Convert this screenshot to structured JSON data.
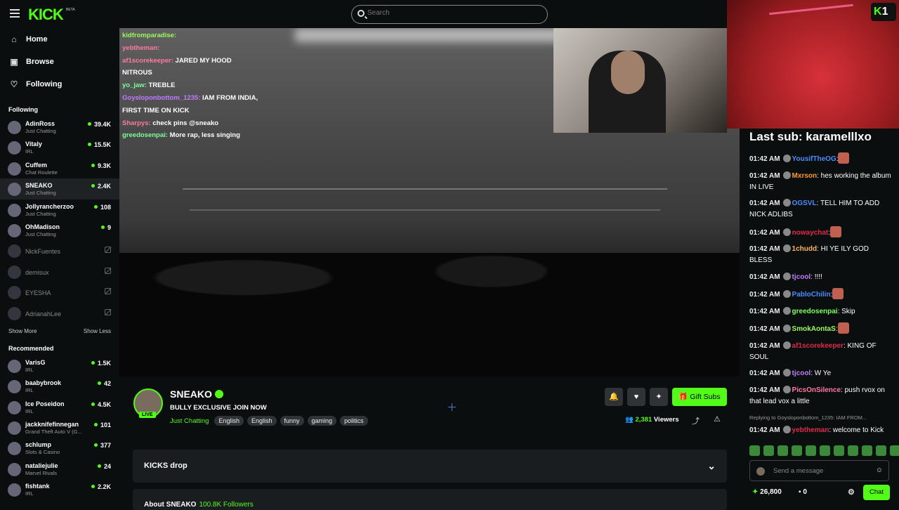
{
  "header": {
    "logo": "KICK",
    "beta": "BETA",
    "search_placeholder": "Search"
  },
  "nav": [
    {
      "icon": "home-icon",
      "glyph": "⌂",
      "label": "Home"
    },
    {
      "icon": "browse-icon",
      "glyph": "▣",
      "label": "Browse"
    },
    {
      "icon": "heart-icon",
      "glyph": "♡",
      "label": "Following"
    }
  ],
  "following_title": "Following",
  "following": [
    {
      "name": "AdinRoss",
      "cat": "Just Chatting",
      "viewers": "39.4K"
    },
    {
      "name": "Vitaly",
      "cat": "IRL",
      "viewers": "15.5K"
    },
    {
      "name": "Cuffem",
      "cat": "Chat Roulette",
      "viewers": "9.3K"
    },
    {
      "name": "SNEAKO",
      "cat": "Just Chatting",
      "viewers": "2.4K"
    },
    {
      "name": "Jollyrancherzoo",
      "cat": "Just Chatting",
      "viewers": "108"
    },
    {
      "name": "OhMadison",
      "cat": "Just Chatting",
      "viewers": "9"
    }
  ],
  "offline": [
    "NickFuentes",
    "demisux",
    "EYESHA",
    "AdrianahLee"
  ],
  "show_more": "Show More",
  "show_less": "Show Less",
  "recommended_title": "Recommended",
  "recommended": [
    {
      "name": "VarisG",
      "cat": "IRL",
      "viewers": "1.5K"
    },
    {
      "name": "baabybrook",
      "cat": "IRL",
      "viewers": "42"
    },
    {
      "name": "Ice Poseidon",
      "cat": "IRL",
      "viewers": "4.5K"
    },
    {
      "name": "jackknifefinnegan",
      "cat": "Grand Theft Auto V (G...",
      "viewers": "101"
    },
    {
      "name": "schlump",
      "cat": "Slots & Casino",
      "viewers": "377"
    },
    {
      "name": "nataliejulie",
      "cat": "Marvel Rivals",
      "viewers": "24"
    },
    {
      "name": "fishtank",
      "cat": "IRL",
      "viewers": "2.2K"
    }
  ],
  "video_chat": [
    {
      "user": "kidfromparadise:",
      "text": ""
    },
    {
      "user": "yebtheman:",
      "text": ""
    },
    {
      "user": "af1scorekeeper:",
      "text": " JARED MY HOOD"
    },
    {
      "user": "",
      "text": "NITROUS"
    },
    {
      "user": "yo_jaw:",
      "text": " TREBLE"
    },
    {
      "user": "Goysloponbottom_1235:",
      "text": " IAM FROM INDIA,"
    },
    {
      "user": "",
      "text": "FIRST TIME ON KICK"
    },
    {
      "user": "Sharpys:",
      "text": " check pins @sneako"
    },
    {
      "user": "greedosenpai:",
      "text": " More rap, less singing"
    }
  ],
  "overlay": {
    "badge": "1",
    "last_sub": "Last sub: karamelllxo"
  },
  "stream": {
    "name": "SNEAKO",
    "live": "LIVE",
    "title": "BULLY EXCLUSIVE JOIN NOW",
    "category": "Just Chatting",
    "tags": [
      "English",
      "English",
      "funny",
      "gaming",
      "politics"
    ],
    "gift": "Gift Subs",
    "viewers": "2,381",
    "viewers_label": "Viewers",
    "drop": "KICKS drop",
    "about": "About SNEAKO",
    "followers": "100.8K Followers"
  },
  "chat": [
    {
      "time": "01:42 AM",
      "user": "YousifTheOG",
      "color": "#4b8bff",
      "text": ":"
    },
    {
      "time": "01:42 AM",
      "user": "Mxrson",
      "color": "#ff9a2e",
      "text": ": hes working the album IN LIVE"
    },
    {
      "time": "01:42 AM",
      "user": "OGSVL",
      "color": "#4b8bff",
      "text": ": TELL HIM TO ADD NICK ADLIBS"
    },
    {
      "time": "01:42 AM",
      "user": "nowaychat",
      "color": "#e0294a",
      "text": ":"
    },
    {
      "time": "01:42 AM",
      "user": "1chudd",
      "color": "#ffb45a",
      "text": ": HI YE ILY GOD BLESS"
    },
    {
      "time": "01:42 AM",
      "user": "tjcool",
      "color": "#c07bff",
      "text": ": !!!!"
    },
    {
      "time": "01:42 AM",
      "user": "PabloChilin",
      "color": "#4b8bff",
      "text": ":"
    },
    {
      "time": "01:42 AM",
      "user": "greedosenpai",
      "color": "#7bff5a",
      "text": ": Skip"
    },
    {
      "time": "01:42 AM",
      "user": "SmokAontaS",
      "color": "#9efb5a",
      "text": ":"
    },
    {
      "time": "01:42 AM",
      "user": "af1scorekeeper",
      "color": "#e0294a",
      "text": ": KING OF SOUL"
    },
    {
      "time": "01:42 AM",
      "user": "tjcool",
      "color": "#c07bff",
      "text": ": W Ye"
    },
    {
      "time": "01:42 AM",
      "user": "PicsOnSilence",
      "color": "#ff7aa0",
      "text": ": push rvox on that lead vox a little"
    }
  ],
  "reply": {
    "label": "Replying to Goysloponbottom_1235: IAM FROM...",
    "time": "01:42 AM",
    "user": "yebtheman",
    "text": ": welcome to Kick"
  },
  "chat_input": {
    "placeholder": "Send a message"
  },
  "chat_footer": {
    "points": "26,800",
    "kicks": "0",
    "chat_button": "Chat"
  },
  "colors": {
    "accent": "#53fc18"
  }
}
